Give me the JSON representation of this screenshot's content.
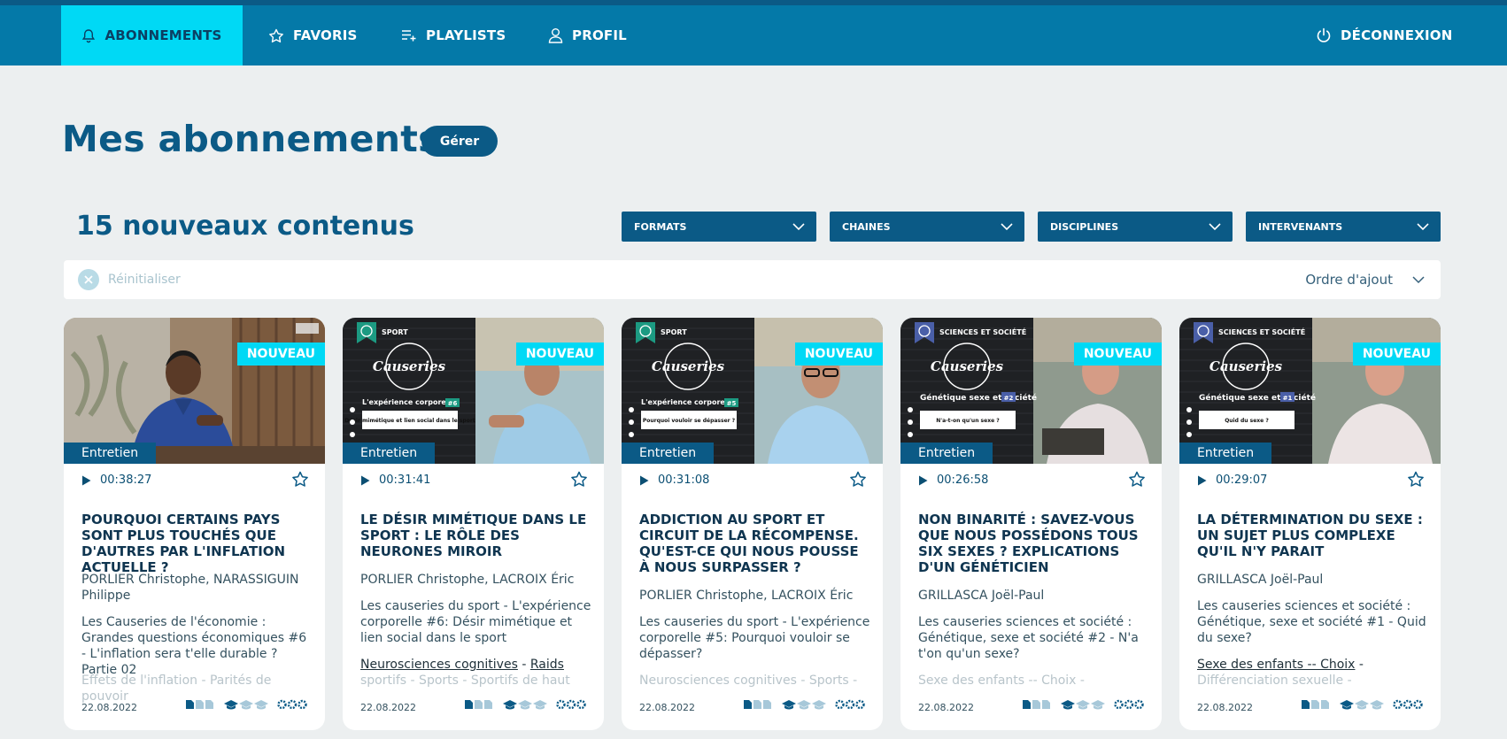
{
  "nav": {
    "items": [
      {
        "label": "ABONNEMENTS",
        "icon": "bell-icon",
        "active": true
      },
      {
        "label": "FAVORIS",
        "icon": "star-icon"
      },
      {
        "label": "PLAYLISTS",
        "icon": "playlist-add-icon"
      },
      {
        "label": "PROFIL",
        "icon": "user-icon"
      }
    ],
    "logout_label": "DÉCONNEXION",
    "logout_icon": "power-icon"
  },
  "page": {
    "title": "Mes abonnements",
    "manage_label": "Gérer",
    "count_title": "15 nouveaux contenus"
  },
  "filters": [
    "FORMATS",
    "CHAINES",
    "DISCIPLINES",
    "INTERVENANTS"
  ],
  "toolbar": {
    "reset_label": "Réinitialiser",
    "sort_label": "Ordre d'ajout"
  },
  "colors": {
    "brand": "#0479a8",
    "dark": "#0b5a86",
    "accent": "#00d9f5",
    "background": "#eceff0"
  },
  "cards": [
    {
      "badge": "NOUVEAU",
      "type": "Entretien",
      "duration": "00:38:27",
      "title": "POURQUOI CERTAINS PAYS SONT PLUS TOUCHÉS QUE D'AUTRES PAR L'INFLATION ACTUELLE ?",
      "authors": "PORLIER Christophe, NARASSIGUIN Philippe",
      "description": "Les Causeries de l'économie : Grandes questions économiques #6 - L'inflation sera t'elle durable ? Partie 02",
      "tags": "Effets de l'inflation - Parités de pouvoir",
      "date": "22.08.2022"
    },
    {
      "badge": "NOUVEAU",
      "type": "Entretien",
      "duration": "00:31:41",
      "channel": "SPORT",
      "episode": "#6",
      "slide_title": "L'expérience corporelle",
      "slide_question": "Désir mimétique et lien social dans le sport",
      "title": "LE DÉSIR MIMÉTIQUE DANS LE SPORT : LE RÔLE DES NEURONES MIROIR",
      "authors": "PORLIER Christophe, LACROIX Éric",
      "description": "Les causeries du sport - L'expérience corporelle #6: Désir mimétique et lien social dans le sport",
      "tag_links": [
        "Neurosciences cognitives",
        "Raids"
      ],
      "tags_more": "sportifs - Sports - Sportifs de haut",
      "date": "22.08.2022"
    },
    {
      "badge": "NOUVEAU",
      "type": "Entretien",
      "duration": "00:31:08",
      "channel": "SPORT",
      "episode": "#5",
      "slide_title": "L'expérience corporelle",
      "slide_question": "Pourquoi vouloir se dépasser ?",
      "title": "ADDICTION AU SPORT ET CIRCUIT DE LA RÉCOMPENSE. QU'EST-CE QUI NOUS POUSSE À NOUS SURPASSER ?",
      "authors": "PORLIER Christophe, LACROIX Éric",
      "description": "Les causeries du sport - L'expérience corporelle #5: Pourquoi vouloir se dépasser?",
      "tags": "Neurosciences cognitives - Sports -",
      "date": "22.08.2022"
    },
    {
      "badge": "NOUVEAU",
      "type": "Entretien",
      "duration": "00:26:58",
      "channel": "SCIENCES ET SOCIÉTÉ",
      "episode": "#2",
      "slide_title": "Génétique sexe et société",
      "slide_question": "N'a-t-on qu'un sexe ?",
      "title": "NON BINARITÉ : SAVEZ-VOUS QUE NOUS POSSÉDONS TOUS SIX SEXES ? EXPLICATIONS D'UN GÉNÉTICIEN",
      "authors": "GRILLASCA Joël-Paul",
      "description": "Les causeries sciences et société : Génétique, sexe et société #2 - N'a t'on qu'un sexe?",
      "tags": "Sexe des enfants -- Choix -",
      "date": "22.08.2022"
    },
    {
      "badge": "NOUVEAU",
      "type": "Entretien",
      "duration": "00:29:07",
      "channel": "SCIENCES ET SOCIÉTÉ",
      "episode": "#1",
      "slide_title": "Génétique sexe et société",
      "slide_question": "Quid du sexe ?",
      "title": "LA DÉTERMINATION DU SEXE : UN SUJET PLUS COMPLEXE QU'IL N'Y PARAIT",
      "authors": "GRILLASCA Joël-Paul",
      "description": "Les causeries sciences et société : Génétique, sexe et société #1 - Quid du sexe?",
      "tag_links": [
        "Sexe des enfants -- Choix"
      ],
      "tags_more": "Différenciation sexuelle -",
      "date": "22.08.2022"
    }
  ],
  "thumb_logo": "Causeries"
}
